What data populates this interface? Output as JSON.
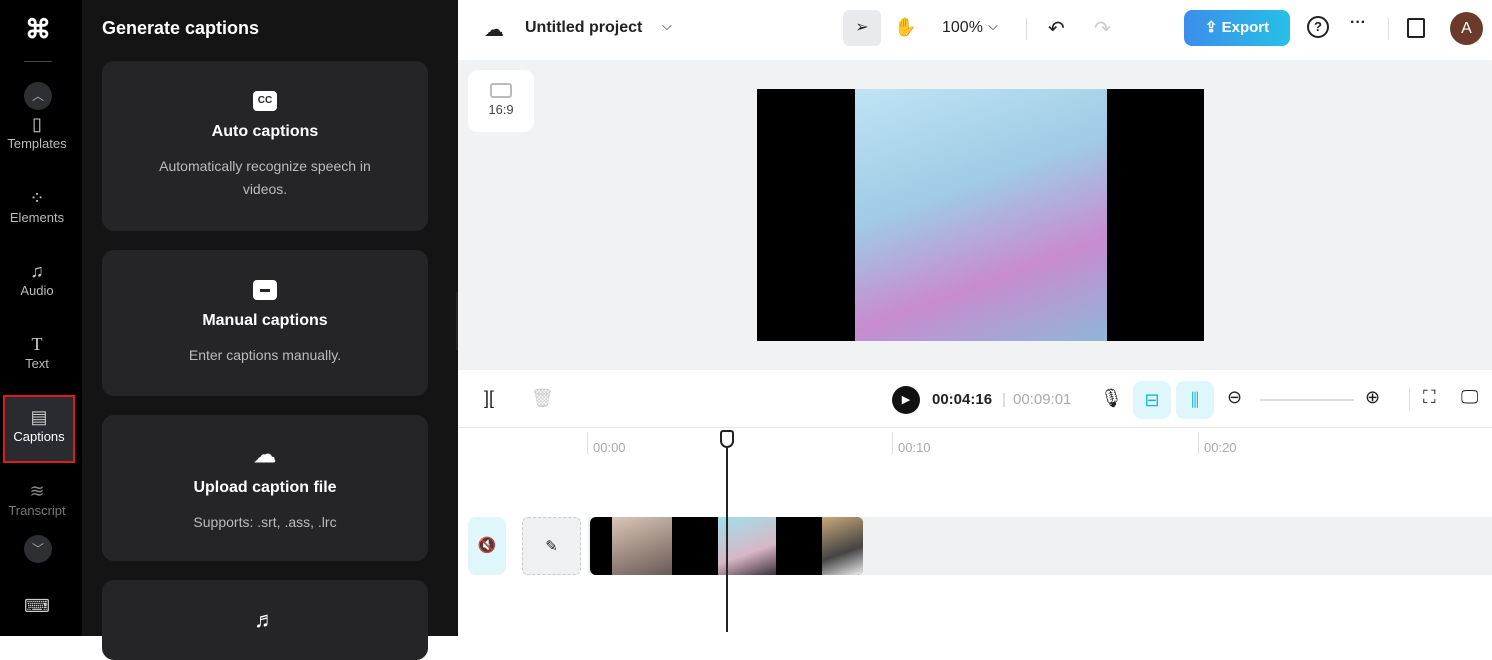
{
  "rail": {
    "items": [
      {
        "label": "Templates",
        "icon": "templates-icon"
      },
      {
        "label": "Elements",
        "icon": "elements-icon"
      },
      {
        "label": "Audio",
        "icon": "music-note-icon"
      },
      {
        "label": "Text",
        "icon": "text-icon"
      },
      {
        "label": "Captions",
        "icon": "captions-icon",
        "active": true
      },
      {
        "label": "Transcript",
        "icon": "transcript-icon"
      }
    ]
  },
  "panel": {
    "title": "Generate captions",
    "cards": [
      {
        "title": "Auto captions",
        "desc": "Automatically recognize speech in videos.",
        "icon": "cc-icon",
        "glyph": "CC"
      },
      {
        "title": "Manual captions",
        "desc": "Enter captions manually.",
        "icon": "subtitle-icon",
        "glyph": "▭"
      },
      {
        "title": "Upload caption file",
        "desc": "Supports: .srt, .ass, .lrc",
        "icon": "cloud-upload-icon",
        "glyph": "☁"
      }
    ]
  },
  "topbar": {
    "project": "Untitled project",
    "zoom": "100%",
    "export": "Export",
    "avatar": "A"
  },
  "canvas": {
    "ratio": "16:9"
  },
  "timeline": {
    "current": "00:04:16",
    "total": "00:09:01",
    "ticks": [
      "00:00",
      "00:10",
      "00:20"
    ]
  },
  "colors": {
    "accent": "#17b8d4",
    "export_start": "#3b8eea",
    "export_end": "#27c0e6",
    "highlight": "#e01b1b"
  }
}
